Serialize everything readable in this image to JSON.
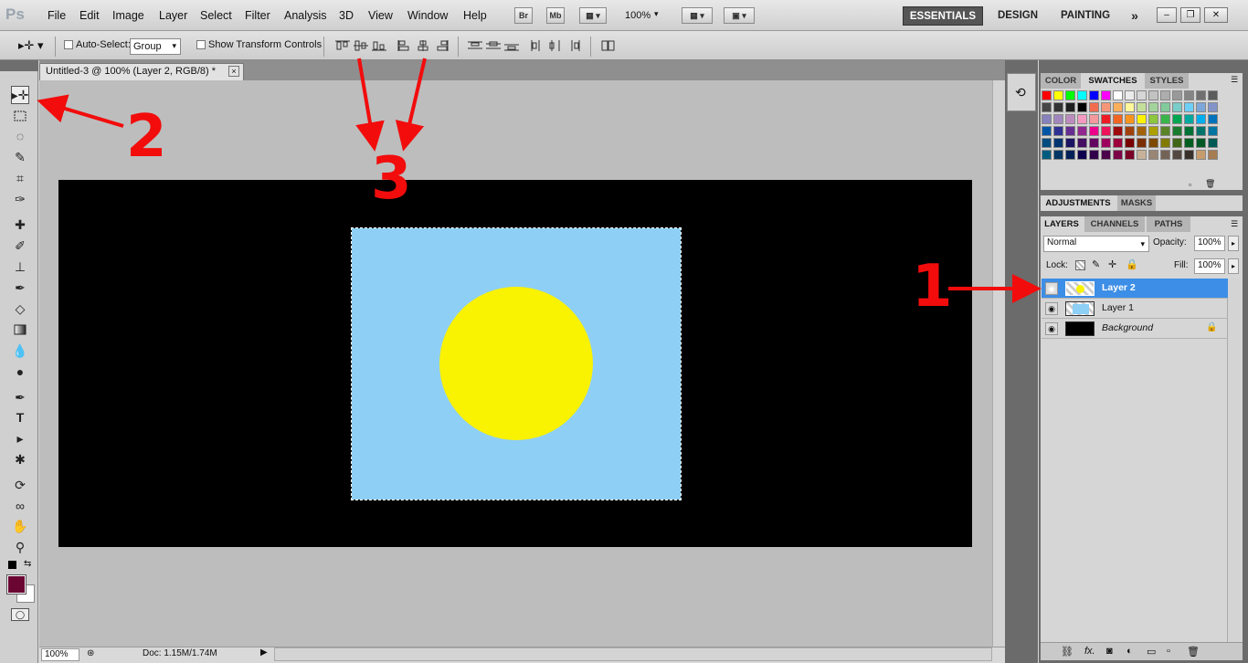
{
  "menubar": {
    "logo": "Ps",
    "items": [
      "File",
      "Edit",
      "Image",
      "Layer",
      "Select",
      "Filter",
      "Analysis",
      "3D",
      "View",
      "Window",
      "Help"
    ],
    "bridge_label": "Br",
    "minibridge_label": "Mb",
    "zoom_label": "100%",
    "workspaces": [
      "ESSENTIALS",
      "DESIGN",
      "PAINTING"
    ],
    "more_label": "»"
  },
  "options": {
    "auto_select_label": "Auto-Select:",
    "auto_select_value": "Group",
    "show_transform_label": "Show Transform Controls"
  },
  "document": {
    "tab_title": "Untitled-3 @ 100% (Layer 2, RGB/8) *",
    "tab_close": "×",
    "colors": {
      "background": "#000000",
      "layer2": "#8ecff5",
      "circle": "#f9f200"
    }
  },
  "status": {
    "zoom": "100%",
    "doc_size": "Doc: 1.15M/1.74M"
  },
  "panels": {
    "top_tabs": [
      "COLOR",
      "SWATCHES",
      "STYLES"
    ],
    "mid_tabs": [
      "ADJUSTMENTS",
      "MASKS"
    ],
    "layer_tabs": [
      "LAYERS",
      "CHANNELS",
      "PATHS"
    ],
    "blend_mode": "Normal",
    "opacity_label": "Opacity:",
    "opacity_value": "100%",
    "lock_label": "Lock:",
    "fill_label": "Fill:",
    "fill_value": "100%",
    "layers": [
      {
        "name": "Layer 2",
        "selected": true
      },
      {
        "name": "Layer 1",
        "selected": false
      },
      {
        "name": "Background",
        "selected": false
      }
    ]
  },
  "swatches": [
    "#ff0000",
    "#ffff00",
    "#00ff00",
    "#00ffff",
    "#0000ff",
    "#ff00ff",
    "#ffffff",
    "#ebebeb",
    "#d6d6d6",
    "#c2c2c2",
    "#adadad",
    "#999999",
    "#858585",
    "#707070",
    "#5c5c5c",
    "#474747",
    "#333333",
    "#1f1f1f",
    "#000000",
    "#f26c4f",
    "#f69679",
    "#fbaf5d",
    "#fff799",
    "#c4df9b",
    "#a3d39c",
    "#82ca9c",
    "#7accc8",
    "#6dcff6",
    "#7da7d9",
    "#8393ca",
    "#8781bd",
    "#a186be",
    "#bd8cbf",
    "#f49ac1",
    "#f5989d",
    "#ed1c24",
    "#f26522",
    "#f7941d",
    "#fff200",
    "#8dc63f",
    "#39b54a",
    "#00a651",
    "#00a99d",
    "#00aeef",
    "#0072bc",
    "#0054a6",
    "#2e3192",
    "#662d91",
    "#92278f",
    "#ec008c",
    "#ed145b",
    "#9e0b0f",
    "#a0410d",
    "#a36209",
    "#aba000",
    "#598527",
    "#1a7b30",
    "#007236",
    "#00746b",
    "#0076a3",
    "#004b80",
    "#003471",
    "#1b1464",
    "#440e62",
    "#630460",
    "#9e005d",
    "#9e0039",
    "#790000",
    "#7b2e00",
    "#7d4900",
    "#827b00",
    "#406618",
    "#005e20",
    "#005826",
    "#005952",
    "#005b7f",
    "#003663",
    "#002157",
    "#0d004c",
    "#32004b",
    "#4b0049",
    "#7b0046",
    "#7a0026",
    "#c7b299",
    "#998675",
    "#736357",
    "#534741",
    "#37302a",
    "#c69c6d",
    "#a67c52"
  ],
  "annotations": {
    "a1": "1",
    "a2": "2",
    "a3": "3"
  }
}
